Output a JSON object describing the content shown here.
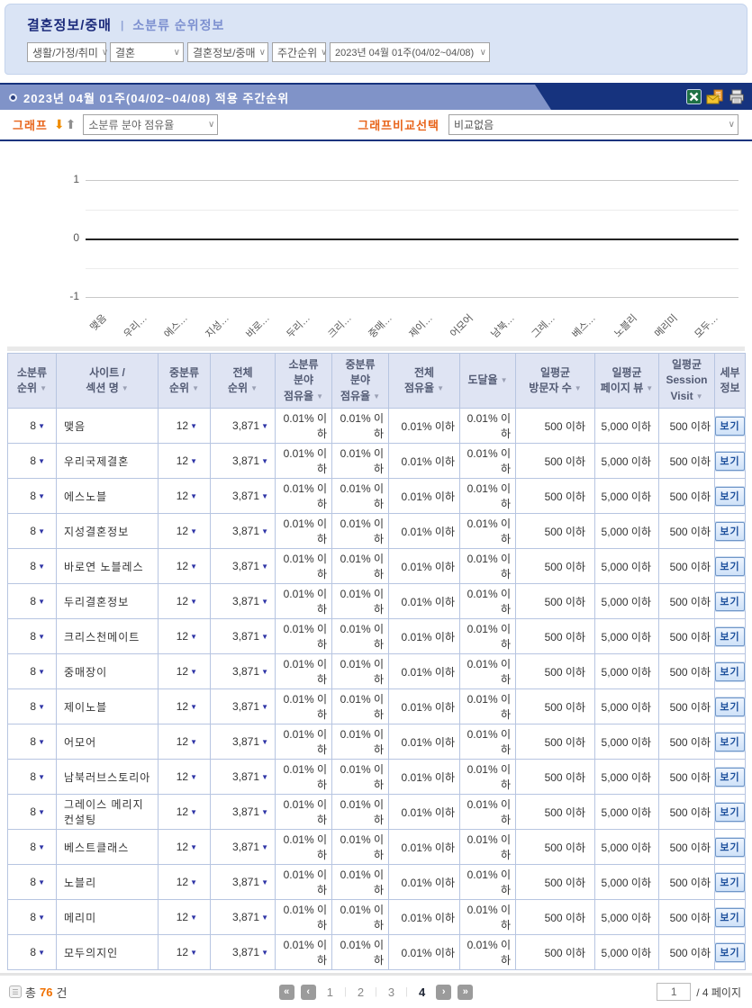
{
  "header": {
    "category_title": "결혼정보/중매",
    "crumb_separator": "|",
    "subtitle": "소분류 순위정보"
  },
  "filters": [
    {
      "value": "생활/가정/취미"
    },
    {
      "value": "결혼"
    },
    {
      "value": "결혼정보/중매"
    },
    {
      "value": "주간순위"
    },
    {
      "value": "2023년 04월 01주(04/02~04/08)"
    }
  ],
  "titlebar": {
    "title": "2023년  04월  01주(04/02~04/08) 적용  주간순위",
    "icons": [
      "excel-icon",
      "mail-report-icon",
      "print-icon"
    ]
  },
  "controls": {
    "graph_label": "그래프",
    "graph_metric_select": "소분류 분야 점유율",
    "compare_label": "그래프비교선택",
    "compare_select": "비교없음"
  },
  "chart_data": {
    "type": "line",
    "title": "",
    "x": [
      "맺음",
      "우리…",
      "에스…",
      "지성…",
      "바로…",
      "두리…",
      "크리…",
      "중매…",
      "제이…",
      "어모어",
      "남북…",
      "그레…",
      "베스…",
      "노블리",
      "메리미",
      "모두…"
    ],
    "series": [],
    "ylim": [
      -1,
      1
    ],
    "yticks": [
      "1",
      "0",
      "-1"
    ],
    "grid": true,
    "legend": "none",
    "note": "empty plot - no series drawn, all values below disclosure threshold"
  },
  "table": {
    "columns": [
      {
        "lines": [
          "소분류",
          "순위"
        ],
        "sort": true
      },
      {
        "lines": [
          "사이트 /",
          "섹션 명"
        ],
        "sort": true
      },
      {
        "lines": [
          "중분류",
          "순위"
        ],
        "sort": true
      },
      {
        "lines": [
          "전체",
          "순위"
        ],
        "sort": true
      },
      {
        "lines": [
          "소분류",
          "분야",
          "점유율"
        ],
        "sort": true
      },
      {
        "lines": [
          "중분류",
          "분야",
          "점유율"
        ],
        "sort": true
      },
      {
        "lines": [
          "전체",
          "점유율"
        ],
        "sort": true
      },
      {
        "lines": [
          "도달율"
        ],
        "sort": true
      },
      {
        "lines": [
          "일평균",
          "방문자 수"
        ],
        "sort": true
      },
      {
        "lines": [
          "일평균",
          "페이지 뷰"
        ],
        "sort": true
      },
      {
        "lines": [
          "일평균",
          "Session",
          "Visit"
        ],
        "sort": true
      },
      {
        "lines": [
          "세부",
          "정보"
        ],
        "sort": false
      }
    ],
    "sites": [
      "맺음",
      "우리국제결혼",
      "에스노블",
      "지성결혼정보",
      "바로연 노블레스",
      "두리결혼정보",
      "크리스천메이트",
      "중매장이",
      "제이노블",
      "어모어",
      "남북러브스토리아",
      "그레이스 메리지컨설팅",
      "베스트클래스",
      "노블리",
      "메리미",
      "모두의지인"
    ],
    "row_common": {
      "small_rank": "8",
      "mid_rank": "12",
      "total_rank": "3,871",
      "small_share": "0.01% 이하",
      "mid_share": "0.01% 이하",
      "total_share": "0.01% 이하",
      "reach": "0.01% 이하",
      "daily_visitors": "500 이하",
      "daily_pageviews": "5,000 이하",
      "daily_session": "500 이하",
      "detail_button": "보기"
    }
  },
  "footer": {
    "total_prefix": "총",
    "total_count": "76",
    "total_suffix": "건",
    "pages": [
      "1",
      "2",
      "3",
      "4"
    ],
    "current_page": "4",
    "page_input_value": "1",
    "page_total_label": "/ 4 페이지"
  },
  "glyphs": {
    "select_chevron": "∨",
    "sort_arrow": "▼",
    "data_arrow": "▼",
    "down_arrow": "⬇",
    "up_arrow": "⬆",
    "first_page": "«",
    "prev_page": "‹",
    "next_page": "›",
    "last_page": "»",
    "list_icon": "☰"
  },
  "colors": {
    "accent_orange": "#e8641a",
    "count_orange": "#f07000",
    "navy": "#16337e",
    "titlebar_blue": "#8093c8",
    "panel_blue": "#dae4f5",
    "table_header_bg": "#dfe4f3",
    "table_border": "#b7c5e1",
    "data_arrow_navy": "#2e34a6",
    "view_button_blue": "#1c4f9c"
  }
}
